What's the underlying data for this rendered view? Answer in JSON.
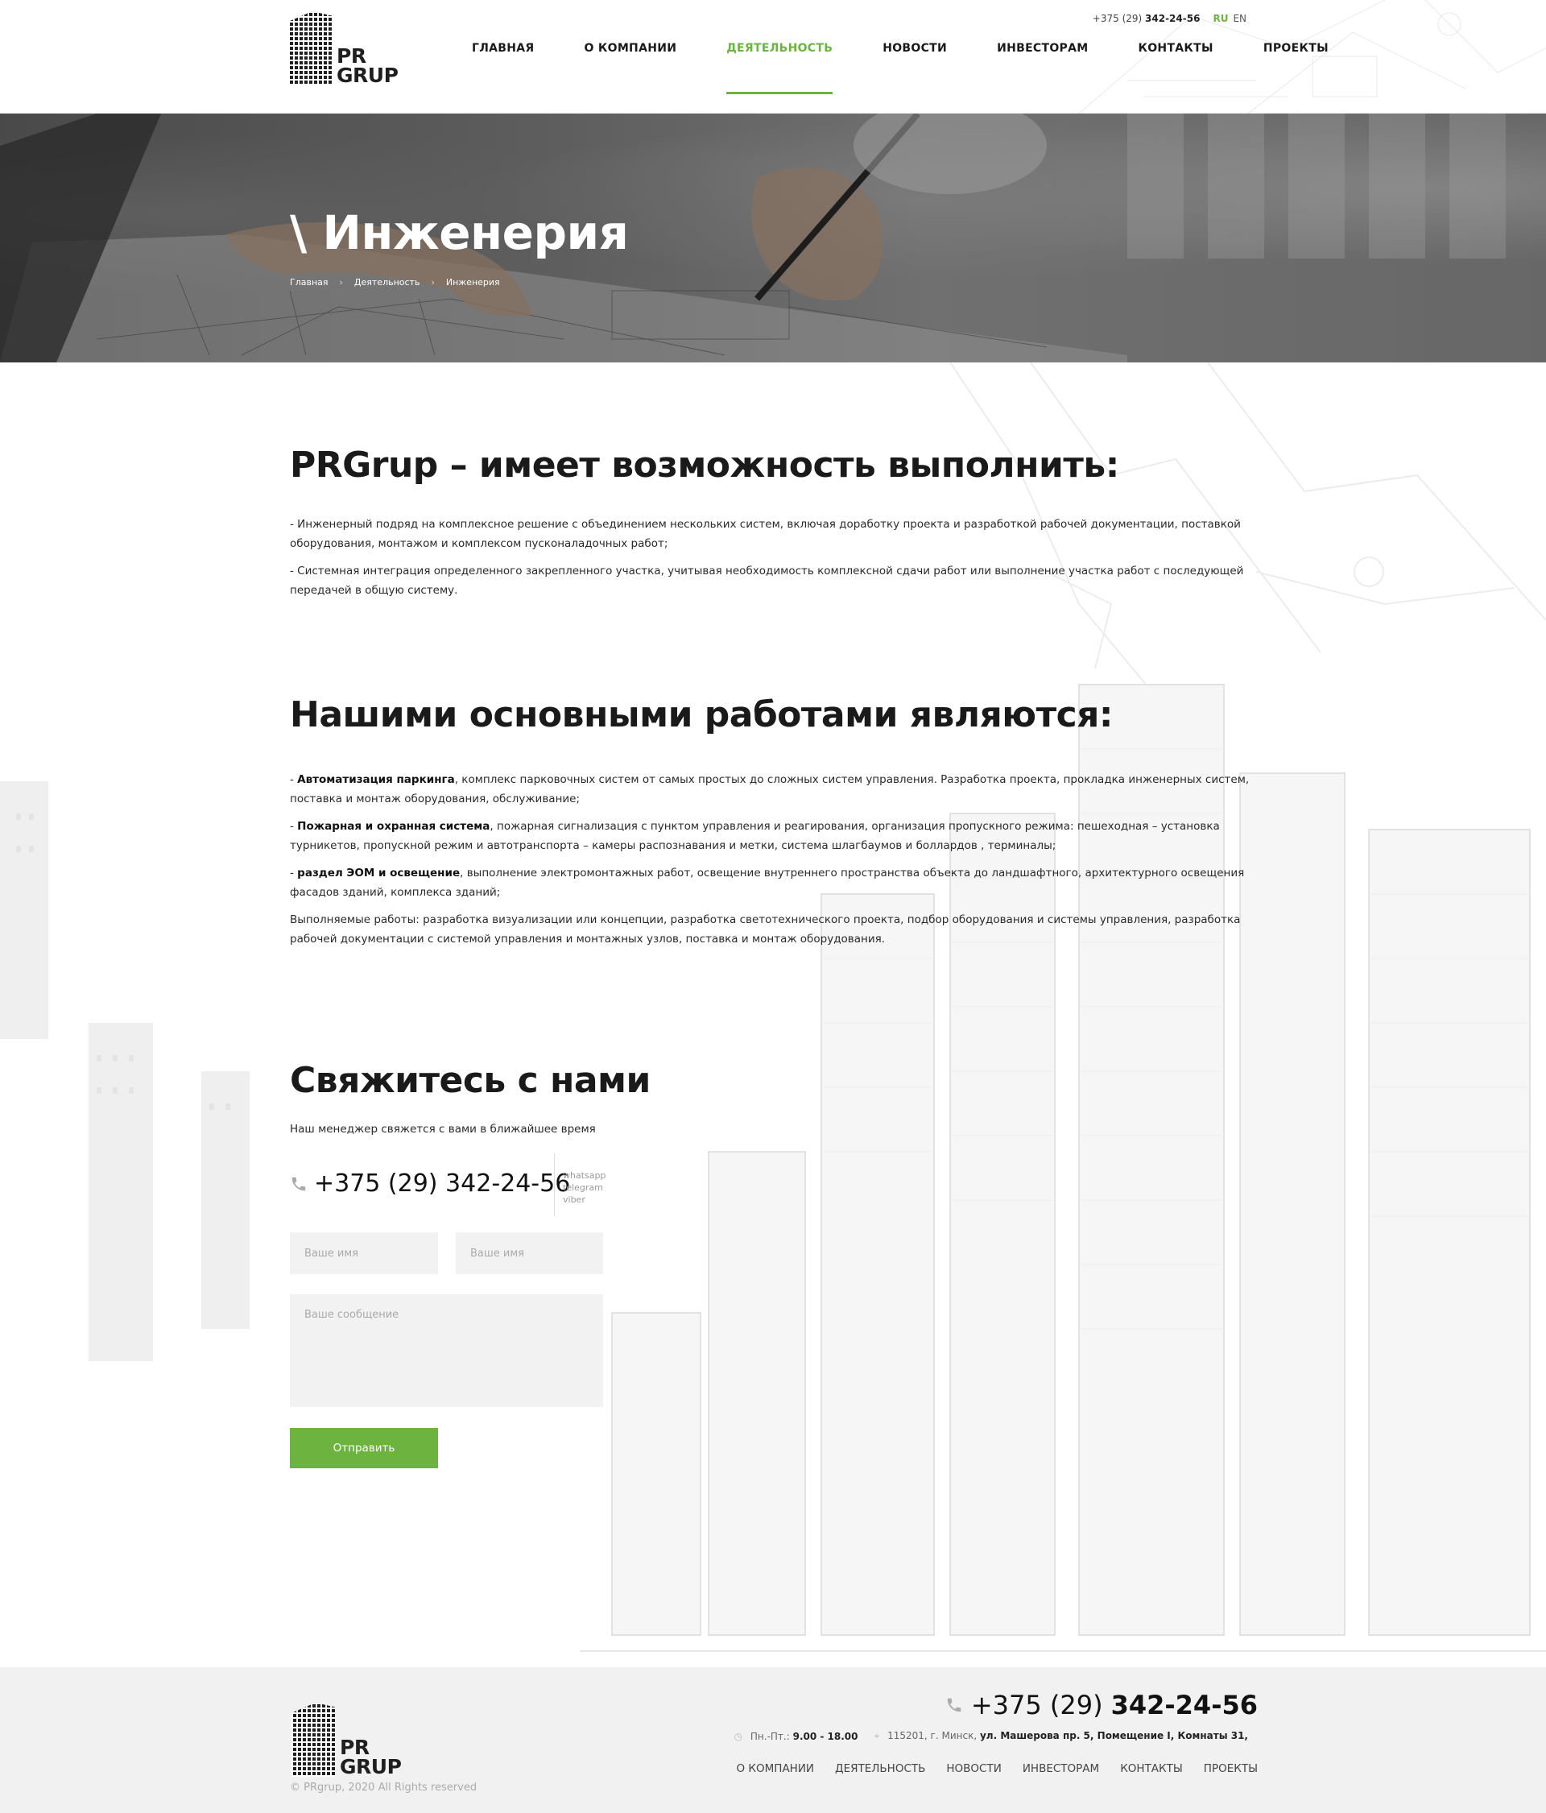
{
  "header": {
    "logo_text_line1": "PR",
    "logo_text_line2": "GRUP",
    "phone_prefix": "+375 (29)",
    "phone_main": "342-24-56",
    "lang_active": "RU",
    "lang_other": "EN",
    "nav": [
      {
        "label": "ГЛАВНАЯ"
      },
      {
        "label": "О КОМПАНИИ"
      },
      {
        "label": "ДЕЯТЕЛЬНОСТЬ",
        "active": true
      },
      {
        "label": "НОВОСТИ"
      },
      {
        "label": "ИНВЕСТОРАМ"
      },
      {
        "label": "КОНТАКТЫ"
      },
      {
        "label": "ПРОЕКТЫ"
      }
    ]
  },
  "hero": {
    "title": "\\ Инженерия",
    "breadcrumbs": [
      "Главная",
      "Деятельность",
      "Инженерия"
    ]
  },
  "section1": {
    "title": "PRGrup – имеет возможность выполнить:",
    "items": [
      "-  Инженерный подряд на комплексное решение с объединением нескольких систем, включая доработку проекта и разработкой рабочей документации, поставкой оборудования, монтажом и комплексом пусконаладочных работ;",
      "- Системная  интеграция определенного закрепленного участка, учитывая необходимость комплексной сдачи работ или выполнение участка работ с последующей передачей в общую систему."
    ]
  },
  "section2": {
    "title": "Нашими основными работами являются:",
    "items": [
      {
        "prefix": "- ",
        "bold": "Автоматизация паркинга",
        "text": ", комплекс парковочных систем от самых простых до сложных систем управления. Разработка проекта, прокладка инженерных систем, поставка и монтаж оборудования, обслуживание;"
      },
      {
        "prefix": "- ",
        "bold": "Пожарная и охранная система",
        "text": ", пожарная сигнализация с пунктом управления и реагирования, организация пропускного режима: пешеходная – установка турникетов, пропускной режим и автотранспорта – камеры распознавания и метки, система шлагбаумов и боллардов , терминалы;"
      },
      {
        "prefix": "- ",
        "bold": "раздел ЭОМ и освещение",
        "text": ", выполнение электромонтажных работ, освещение внутреннего пространства объекта до ландшафтного, архитектурного освещения фасадов зданий, комплекса зданий;"
      },
      {
        "prefix": "",
        "bold": "",
        "text": "Выполняемые работы:  разработка визуализации или концепции, разработка светотехнического проекта, подбор оборудования и системы управления, разработка рабочей документации с системой управления и монтажных узлов, поставка и монтаж оборудования."
      }
    ]
  },
  "contact": {
    "title": "Свяжитесь с нами",
    "subtitle": "Наш менеджер свяжется с вами в ближайшее время",
    "phone": "+375 (29) 342-24-56",
    "messengers": [
      "whatsapp",
      "telegram",
      "viber"
    ],
    "name_placeholder_1": "Ваше имя",
    "name_placeholder_2": "Ваше имя",
    "message_placeholder": "Ваше сообщение",
    "submit_label": "Отправить"
  },
  "footer": {
    "logo_text_line1": "PR",
    "logo_text_line2": "GRUP",
    "phone_prefix": "+375 (29)",
    "phone_main": "342-24-56",
    "hours_label": "Пн.-Пт.:",
    "hours_value": "9.00 - 18.00",
    "address_prefix": "115201, г. Минск,",
    "address_main": "ул. Машерова пр. 5, Помещение I, Комнаты 31,",
    "copyright": "© PRgrup, 2020 All Rights reserved",
    "nav": [
      "О КОМПАНИИ",
      "ДЕЯТЕЛЬНОСТЬ",
      "НОВОСТИ",
      "ИНВЕСТОРАМ",
      "КОНТАКТЫ",
      "ПРОЕКТЫ"
    ]
  },
  "colors": {
    "accent": "#6db33f",
    "text": "#1a1a1a",
    "field_bg": "#f2f2f2",
    "footer_bg": "#f1f1f1"
  }
}
